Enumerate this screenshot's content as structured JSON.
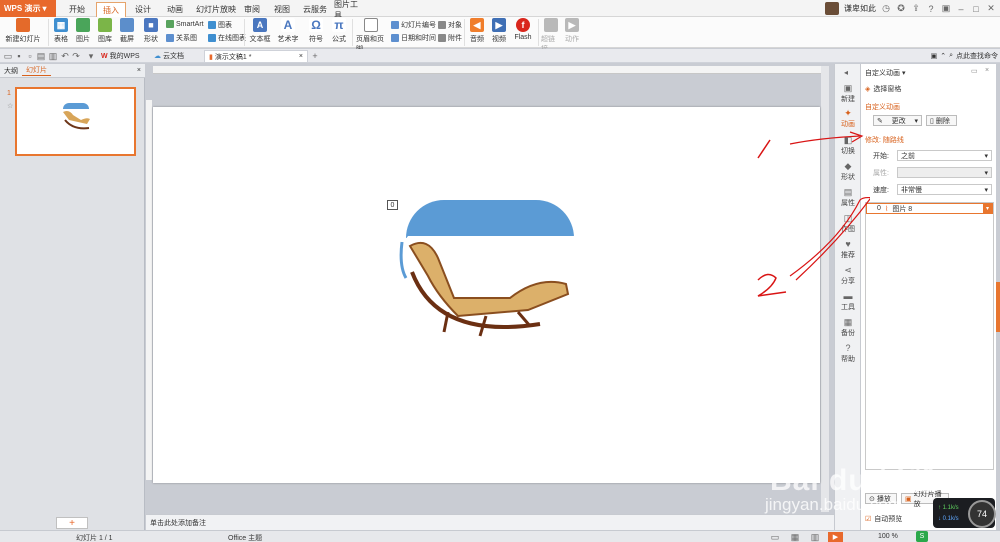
{
  "app": {
    "name": "WPS 演示"
  },
  "menu_tabs": [
    "开始",
    "插入",
    "设计",
    "动画",
    "幻灯片放映",
    "审阅",
    "视图",
    "云服务",
    "图片工具"
  ],
  "user": {
    "name": "谦卑如此",
    "dropdown": "▾"
  },
  "ribbon": {
    "new_slide": "新建幻灯片",
    "table": "表格",
    "picture": "图片",
    "gallery": "图库",
    "screenshot": "截屏",
    "shape": "形状",
    "smartart": "SmartArt",
    "chart": "图表",
    "relation": "关系图",
    "online_chart": "在线图表",
    "textbox": "文本框",
    "wordart": "艺术字",
    "symbol": "符号",
    "formula": "公式",
    "header_footer": "页眉和页脚",
    "slide_number": "幻灯片编号",
    "object": "对象",
    "date_time": "日期和时间",
    "attachment": "附件",
    "audio": "音频",
    "video": "视频",
    "flash": "Flash",
    "hyperlink": "超链接",
    "action": "动作"
  },
  "doc_tabs": [
    "我的WPS",
    "云文档",
    "演示文稿1 *"
  ],
  "search_cmd": "点此查找命令",
  "left_panel": {
    "tabs": [
      "大纲",
      "幻灯片"
    ],
    "slide_number": "1",
    "add_button": "+"
  },
  "slide": {
    "animation_marker": "0"
  },
  "notes_placeholder": "单击此处添加备注",
  "right_strip": [
    "新建",
    "动画",
    "切换",
    "形状",
    "属性",
    "作图",
    "推荐",
    "分享",
    "工具",
    "备份",
    "帮助"
  ],
  "pane": {
    "title": "自定义动画",
    "select_pane": "选择窗格",
    "section": "自定义动画",
    "change_btn": "更改",
    "delete_btn": "删除",
    "effect_title": "修改: 随路线",
    "start_label": "开始:",
    "start_value": "之前",
    "property_label": "属性:",
    "speed_label": "速度:",
    "speed_value": "非常慢",
    "item_index": "0",
    "item_name": "图片 8",
    "play_btn": "播放",
    "slideshow_btn": "幻灯片播放",
    "autopreview": "自动预览"
  },
  "annotations": {
    "one": "1",
    "two": "2"
  },
  "status": {
    "slide_info": "幻灯片 1 / 1",
    "theme": "Office 主题",
    "zoom": "100 %"
  },
  "net_widget": {
    "up": "1.1k/s",
    "down": "0.1k/s",
    "percent": "74"
  },
  "watermark": {
    "brand": "Bai du 经验",
    "url": "jingyan.baidu.com"
  },
  "colors": {
    "accent": "#e8692c",
    "slide_blue": "#5b9bd5",
    "annotation_red": "#d91414"
  }
}
